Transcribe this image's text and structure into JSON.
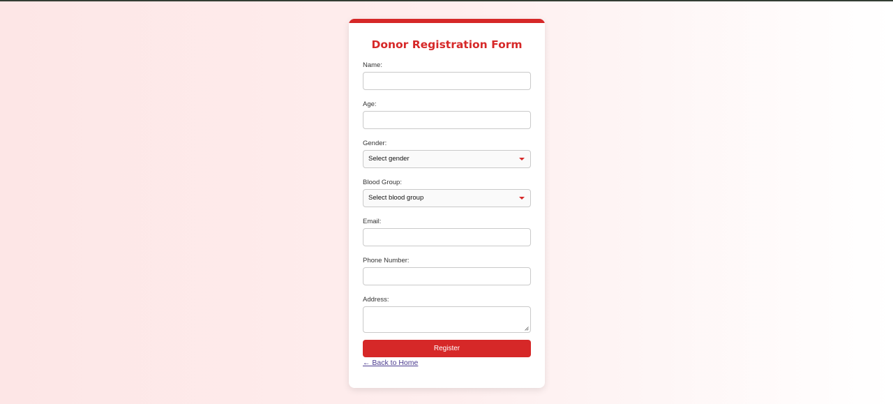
{
  "form": {
    "title": "Donor Registration Form",
    "fields": {
      "name": {
        "label": "Name:",
        "value": ""
      },
      "age": {
        "label": "Age:",
        "value": ""
      },
      "gender": {
        "label": "Gender:",
        "selected": "Select gender"
      },
      "blood_group": {
        "label": "Blood Group:",
        "selected": "Select blood group"
      },
      "email": {
        "label": "Email:",
        "value": ""
      },
      "phone": {
        "label": "Phone Number:",
        "value": ""
      },
      "address": {
        "label": "Address:",
        "value": ""
      }
    },
    "submit_label": "Register",
    "back_link": "← Back to Home"
  },
  "colors": {
    "accent": "#d62828",
    "link": "#4b3b8f",
    "card": "#ffffff"
  },
  "icons": {
    "select_caret": "caret-down-icon",
    "textarea_resize": "resize-handle-icon"
  }
}
